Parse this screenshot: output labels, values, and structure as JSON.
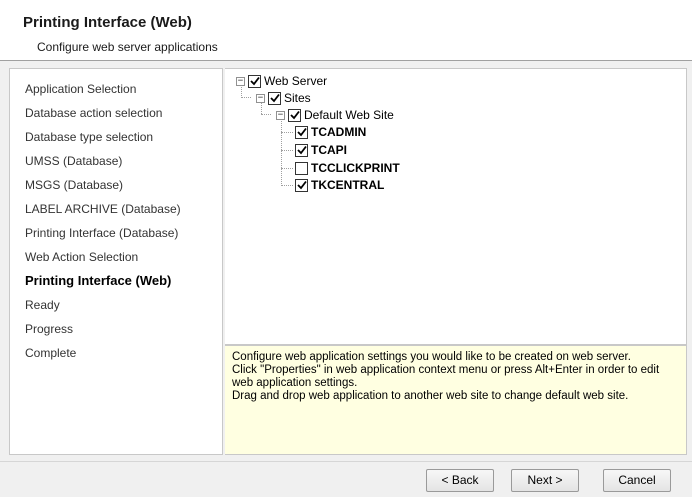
{
  "header": {
    "title": "Printing Interface (Web)",
    "subtitle": "Configure web server applications"
  },
  "nav": {
    "items": [
      {
        "label": "Application Selection"
      },
      {
        "label": "Database action selection"
      },
      {
        "label": "Database type selection"
      },
      {
        "label": "UMSS (Database)"
      },
      {
        "label": "MSGS (Database)"
      },
      {
        "label": "LABEL ARCHIVE (Database)"
      },
      {
        "label": "Printing Interface (Database)"
      },
      {
        "label": "Web Action Selection"
      },
      {
        "label": "Printing Interface (Web)",
        "active": true
      },
      {
        "label": "Ready"
      },
      {
        "label": "Progress"
      },
      {
        "label": "Complete"
      }
    ]
  },
  "tree": {
    "root": {
      "label": "Web Server",
      "checked": true,
      "expanded": true
    },
    "sites": {
      "label": "Sites",
      "checked": true,
      "expanded": true
    },
    "default_site": {
      "label": "Default Web Site",
      "checked": true,
      "expanded": true
    },
    "apps": [
      {
        "label": "TCADMIN",
        "checked": true
      },
      {
        "label": "TCAPI",
        "checked": true
      },
      {
        "label": "TCCLICKPRINT",
        "checked": false
      },
      {
        "label": "TKCENTRAL",
        "checked": true
      }
    ]
  },
  "help": {
    "line1": "Configure web application settings you would like to be created on web server.",
    "line2": "Click \"Properties\" in web application context menu or press Alt+Enter in order to edit web application settings.",
    "line3": "Drag and drop web application to another web site to change default web site."
  },
  "buttons": {
    "back": "< Back",
    "next": "Next >",
    "cancel": "Cancel"
  },
  "icons": {
    "expander_expanded": "minus-box-icon",
    "checkbox_checked": "checkmark-icon"
  }
}
